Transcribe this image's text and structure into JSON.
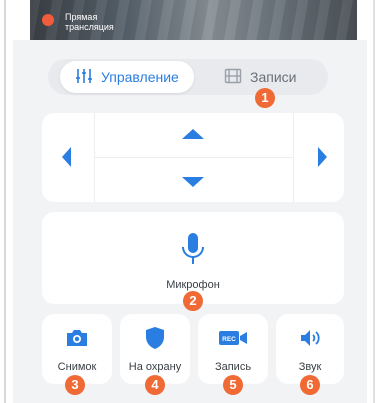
{
  "colors": {
    "accent": "#2a7de1",
    "badge": "#f06a35",
    "live": "#f25c3a"
  },
  "video": {
    "live_label_line1": "Прямая",
    "live_label_line2": "трансляция"
  },
  "tabs": [
    {
      "label": "Управление",
      "icon": "sliders-icon",
      "active": true
    },
    {
      "label": "Записи",
      "icon": "film-icon",
      "active": false
    }
  ],
  "ptz": {
    "left": "arrow-left-icon",
    "up": "arrow-up-icon",
    "down": "arrow-down-icon",
    "right": "arrow-right-icon"
  },
  "microphone": {
    "label": "Микрофон",
    "icon": "microphone-icon"
  },
  "actions": [
    {
      "label": "Снимок",
      "icon": "camera-icon"
    },
    {
      "label": "На охрану",
      "icon": "shield-icon"
    },
    {
      "label": "Запись",
      "icon": "record-camera-icon",
      "icon_text": "REC"
    },
    {
      "label": "Звук",
      "icon": "speaker-icon"
    }
  ],
  "badges": [
    "1",
    "2",
    "3",
    "4",
    "5",
    "6"
  ]
}
